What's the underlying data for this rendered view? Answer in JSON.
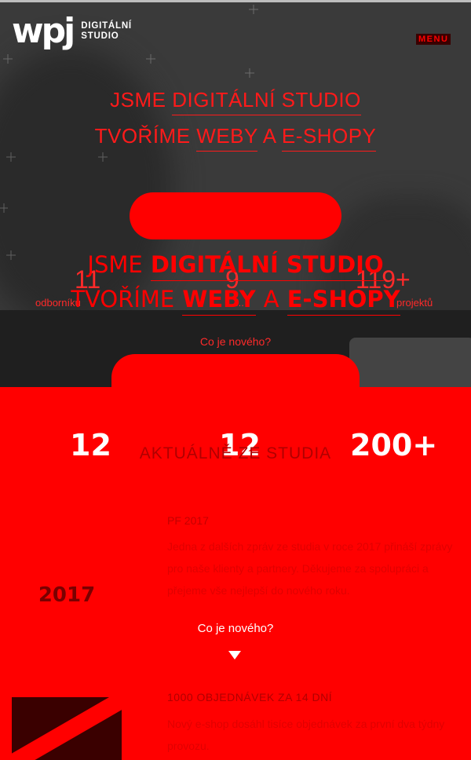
{
  "header": {
    "logo_mark": "wpj",
    "logo_line1": "DIGITÁLNÍ",
    "logo_line2": "STUDIO",
    "menu_label": "MENU"
  },
  "hero": {
    "line1_prefix": "JSME",
    "line1_highlight": "DIGITÁLNÍ STUDIO",
    "line2_prefix": "TVOŘÍME",
    "line2_highlight_a": "WEBY",
    "line2_mid": "A",
    "line2_highlight_b": "E-SHOPY",
    "news_link": "Co je nového?"
  },
  "hero_stats": [
    {
      "number": "11",
      "label": "odborníků"
    },
    {
      "number": "9",
      "label": "..."
    },
    {
      "number": "119+",
      "label": "projektů"
    }
  ],
  "big_stats": [
    "12",
    "12",
    "200+"
  ],
  "section": {
    "title": "AKTUÁLNĚ ZE STUDIA"
  },
  "news": [
    {
      "date": "PF 2017",
      "body": "Jedna z dalších zpráv ze studia v roce 2017 přináší zprávy pro naše klienty a partnery. Děkujeme za spolupráci a přejeme vše nejlepší do nového roku.",
      "thumb_text": "2017"
    },
    {
      "heading": "1000 OBJEDNÁVEK ZA 14 DNÍ",
      "body": "Nový e-shop dosáhl tisíce objednávek za první dva týdny provozu."
    }
  ],
  "overlay": {
    "news_link": "Co je nového?"
  }
}
